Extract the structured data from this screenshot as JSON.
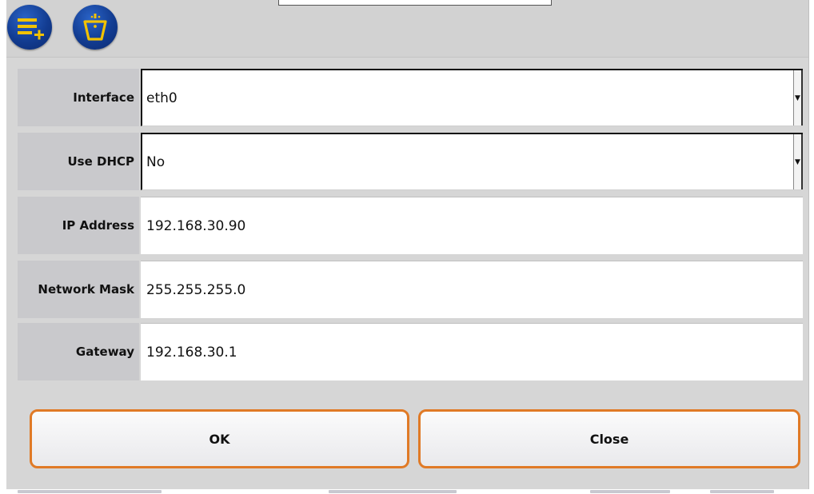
{
  "toolbar": {
    "add_icon": "add-list-icon",
    "clear_icon": "clear-bucket-icon"
  },
  "form": {
    "rows": [
      {
        "label": "Interface",
        "value": "eth0",
        "type": "select"
      },
      {
        "label": "Use DHCP",
        "value": "No",
        "type": "select"
      },
      {
        "label": "IP Address",
        "value": "192.168.30.90",
        "type": "text"
      },
      {
        "label": "Network Mask",
        "value": "255.255.255.0",
        "type": "text"
      },
      {
        "label": "Gateway",
        "value": "192.168.30.1",
        "type": "text"
      }
    ]
  },
  "buttons": {
    "ok_label": "OK",
    "close_label": "Close"
  },
  "colors": {
    "button_border": "#e07a26",
    "label_bg": "#c9c9cc",
    "icon_blue": "#123c91",
    "icon_yellow": "#f2c200"
  }
}
